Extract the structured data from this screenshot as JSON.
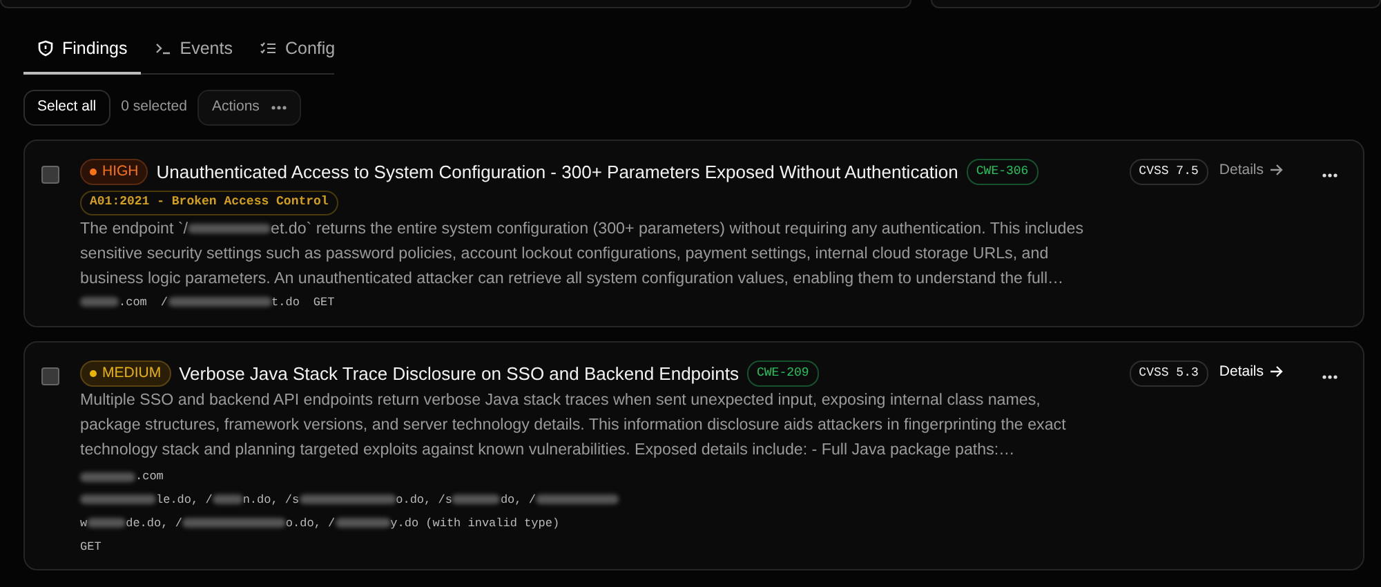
{
  "tabs": [
    {
      "label": "Findings",
      "selected": true
    },
    {
      "label": "Events",
      "selected": false
    },
    {
      "label": "Config",
      "selected": false
    }
  ],
  "toolbar": {
    "select_all": "Select all",
    "selection_count": "0 selected",
    "actions": "Actions"
  },
  "findings": [
    {
      "checked": false,
      "severity": {
        "kind": "high",
        "label": "HIGH"
      },
      "title": "Unauthenticated Access to System Configuration - 300+ Parameters Exposed Without Authentication",
      "cwe": "CWE-306",
      "owasp": "A01:2021 - Broken Access Control",
      "cvss": "CVSS 7.5",
      "details": {
        "label": "Details",
        "highlighted": false
      },
      "description": [
        {
          "kind": "text",
          "text": "The endpoint `/"
        },
        {
          "kind": "redacted"
        },
        {
          "kind": "text",
          "text": "et.do` returns the entire system configuration (300+ parameters) without requiring any authentication. This includes sensitive security settings such as password policies, account lockout configurations, payment settings, internal cloud storage URLs, and business logic parameters. An unauthenticated attacker can retrieve all system configuration values, enabling them to understand the full…"
        }
      ],
      "locations": [
        [
          {
            "kind": "redacted"
          },
          {
            "kind": "text",
            "text": ".com"
          }
        ],
        [
          {
            "kind": "text",
            "text": "/"
          },
          {
            "kind": "redacted"
          },
          {
            "kind": "text",
            "text": "t.do"
          }
        ]
      ],
      "method": "GET"
    },
    {
      "checked": false,
      "severity": {
        "kind": "medium",
        "label": "MEDIUM"
      },
      "title": "Verbose Java Stack Trace Disclosure on SSO and Backend Endpoints",
      "cwe": "CWE-209",
      "cvss": "CVSS 5.3",
      "details": {
        "label": "Details",
        "highlighted": true
      },
      "description": [
        {
          "kind": "text",
          "text": "Multiple SSO and backend API endpoints return verbose Java stack traces when sent unexpected input, exposing internal class names, package structures, framework versions, and server technology details. This information disclosure aids attackers in fingerprinting the exact technology stack and planning targeted exploits against known vulnerabilities. Exposed details include: - Full Java package paths:…"
        }
      ],
      "locations": [
        [
          {
            "kind": "redacted"
          },
          {
            "kind": "text",
            "text": ".com"
          }
        ],
        [
          {
            "kind": "redacted"
          },
          {
            "kind": "text",
            "text": "le.do, /"
          },
          {
            "kind": "redacted"
          },
          {
            "kind": "text",
            "text": "n.do, /s"
          },
          {
            "kind": "redacted"
          },
          {
            "kind": "text",
            "text": "o.do, /s"
          },
          {
            "kind": "redacted"
          },
          {
            "kind": "text",
            "text": "do, /"
          },
          {
            "kind": "redacted"
          }
        ],
        [
          {
            "kind": "text",
            "text": "w"
          },
          {
            "kind": "redacted"
          },
          {
            "kind": "text",
            "text": "de.do, /"
          },
          {
            "kind": "redacted"
          },
          {
            "kind": "text",
            "text": "o.do, /"
          },
          {
            "kind": "redacted"
          },
          {
            "kind": "text",
            "text": "y.do (with invalid type)"
          }
        ]
      ],
      "method": "GET"
    }
  ]
}
